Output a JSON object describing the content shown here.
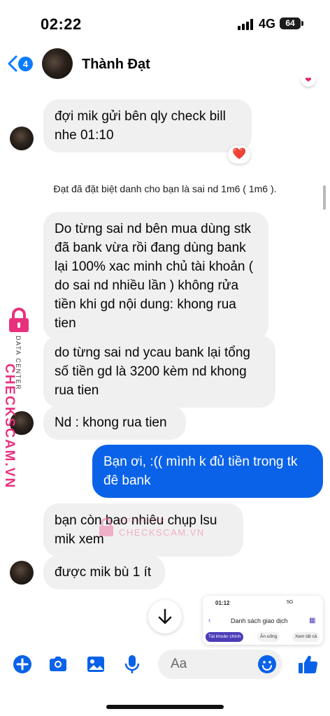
{
  "status_bar": {
    "time": "02:22",
    "network": "4G",
    "battery": "64"
  },
  "header": {
    "back_badge": "4",
    "contact_name": "Thành Đạt"
  },
  "messages": [
    {
      "text": "đợi mik gửi bên qly check bill nhe 01:10",
      "reaction": "❤️"
    },
    {
      "text": "Do từng sai nd bên mua dùng stk đã bank vừa rồi đang dùng bank lại 100% xac minh chủ tài khoản ( do sai nd nhiều lần ) không rửa tiền khi  gd nội dung: khong rua tien"
    },
    {
      "text": "do từng sai nd ycau bank lại tổng số tiền gd là 3200 kèm nd khong rua tien"
    },
    {
      "text": "Nd : khong rua tien"
    },
    {
      "text": "Bạn ơi, :(( mình k đủ tiền trong tk đê bank"
    },
    {
      "text": "bạn còn bao nhiêu chụp lsu mik xem"
    },
    {
      "text": "được mik bù 1 ít"
    }
  ],
  "system_note": "Đạt đã đặt biệt danh cho bạn là sai nd 1m6 ( 1m6 ).",
  "watermark": {
    "brand": "CHECKSCAM.VN",
    "subtitle": "DATA CENTER"
  },
  "attachment_preview": {
    "time": "01:12",
    "status": "5G",
    "title": "Danh sách giao dịch",
    "chips": [
      "Tài khoản chính",
      "Ăn uống",
      "Xem tất cả"
    ]
  },
  "composer": {
    "placeholder": "Aa"
  },
  "colors": {
    "accent": "#0a62e8",
    "brand_pink": "#e8317d"
  },
  "icons": [
    "back-chevron-icon",
    "plus-icon",
    "camera-icon",
    "image-icon",
    "microphone-icon",
    "emoji-icon",
    "thumbs-up-icon",
    "arrow-down-icon"
  ]
}
